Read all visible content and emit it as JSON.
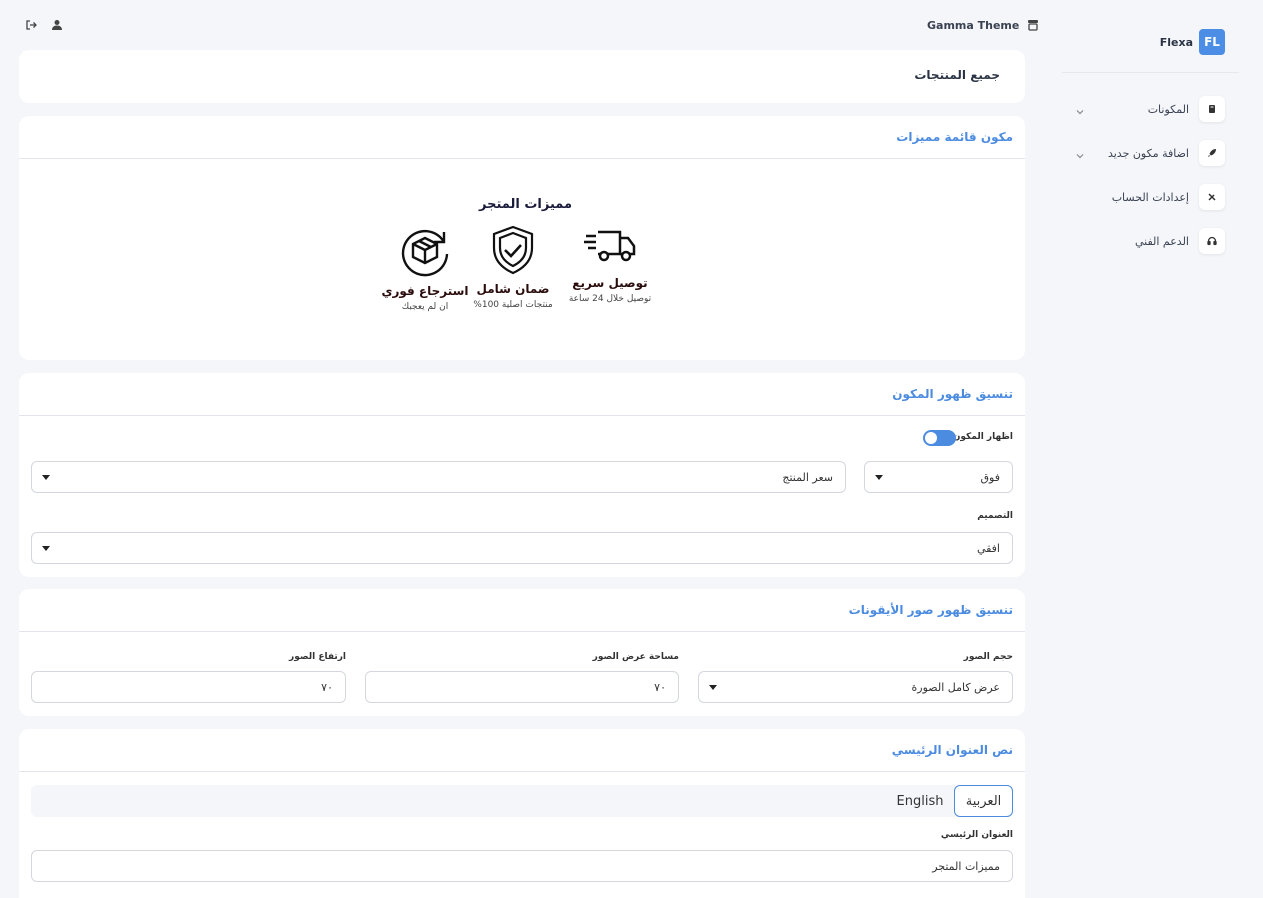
{
  "topbar": {
    "theme_name": "Gamma Theme"
  },
  "sidebar": {
    "brand_name": "Flexa",
    "brand_logo": "FL",
    "items": [
      {
        "label": "المكونات",
        "icon": "book-icon",
        "has_chevron": true
      },
      {
        "label": "اضافة مكون جديد",
        "icon": "rocket-icon",
        "has_chevron": true
      },
      {
        "label": "إعدادات الحساب",
        "icon": "tools-icon",
        "has_chevron": false
      },
      {
        "label": "الدعم الفني",
        "icon": "headset-icon",
        "has_chevron": false
      }
    ]
  },
  "page": {
    "title": "جميع المنتجات"
  },
  "preview": {
    "card_title": "مكون قائمة مميزات",
    "heading": "مميزات المتجر",
    "features": [
      {
        "title": "توصيل سريع",
        "subtitle": "توصيل خلال 24 ساعة",
        "icon": "truck-icon"
      },
      {
        "title": "ضمان شامل",
        "subtitle": "منتجات اصلية 100%",
        "icon": "shield-check-icon"
      },
      {
        "title": "استرجاع فوري",
        "subtitle": "ان لم يعجبك",
        "icon": "box-return-icon"
      }
    ]
  },
  "layout_settings": {
    "card_title": "تنسيق ظهور المكون",
    "show_label": "اظهار المكون",
    "position_value": "فوق",
    "anchor_value": "سعر المنتج",
    "design_label": "التصميم",
    "design_value": "افقي"
  },
  "icon_settings": {
    "card_title": "تنسيق ظهور صور الأيقونات",
    "size_label": "حجم الصور",
    "size_value": "عرض كامل الصورة",
    "width_label": "مساحة عرض الصور",
    "width_value": "٧٠",
    "height_label": "ارتفاع الصور",
    "height_value": "٧٠"
  },
  "heading_text": {
    "card_title": "نص العنوان الرئيسي",
    "tab_arabic": "العربية",
    "tab_english": "English",
    "field_label": "العنوان الرئيسي",
    "field_value": "مميزات المتجر"
  },
  "colors": {
    "accent": "#4b8be0",
    "background": "#f5f6fa"
  }
}
